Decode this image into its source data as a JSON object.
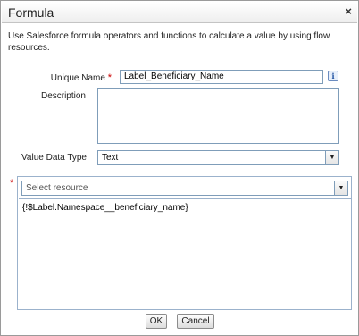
{
  "dialog": {
    "title": "Formula",
    "close_symbol": "×",
    "description": "Use Salesforce formula operators and functions to calculate a value by using flow resources."
  },
  "form": {
    "unique_name_label": "Unique Name",
    "unique_name_value": "Label_Beneficiary_Name",
    "required_marker": "*",
    "info_symbol": "i",
    "description_label": "Description",
    "description_value": "",
    "value_data_type_label": "Value Data Type",
    "value_data_type_value": "Text"
  },
  "formula": {
    "resource_placeholder": "Select resource",
    "formula_text": "{!$Label.Namespace__beneficiary_name}"
  },
  "buttons": {
    "ok_label": "OK",
    "cancel_label": "Cancel"
  },
  "icons": {
    "dropdown_arrow": "▼"
  }
}
